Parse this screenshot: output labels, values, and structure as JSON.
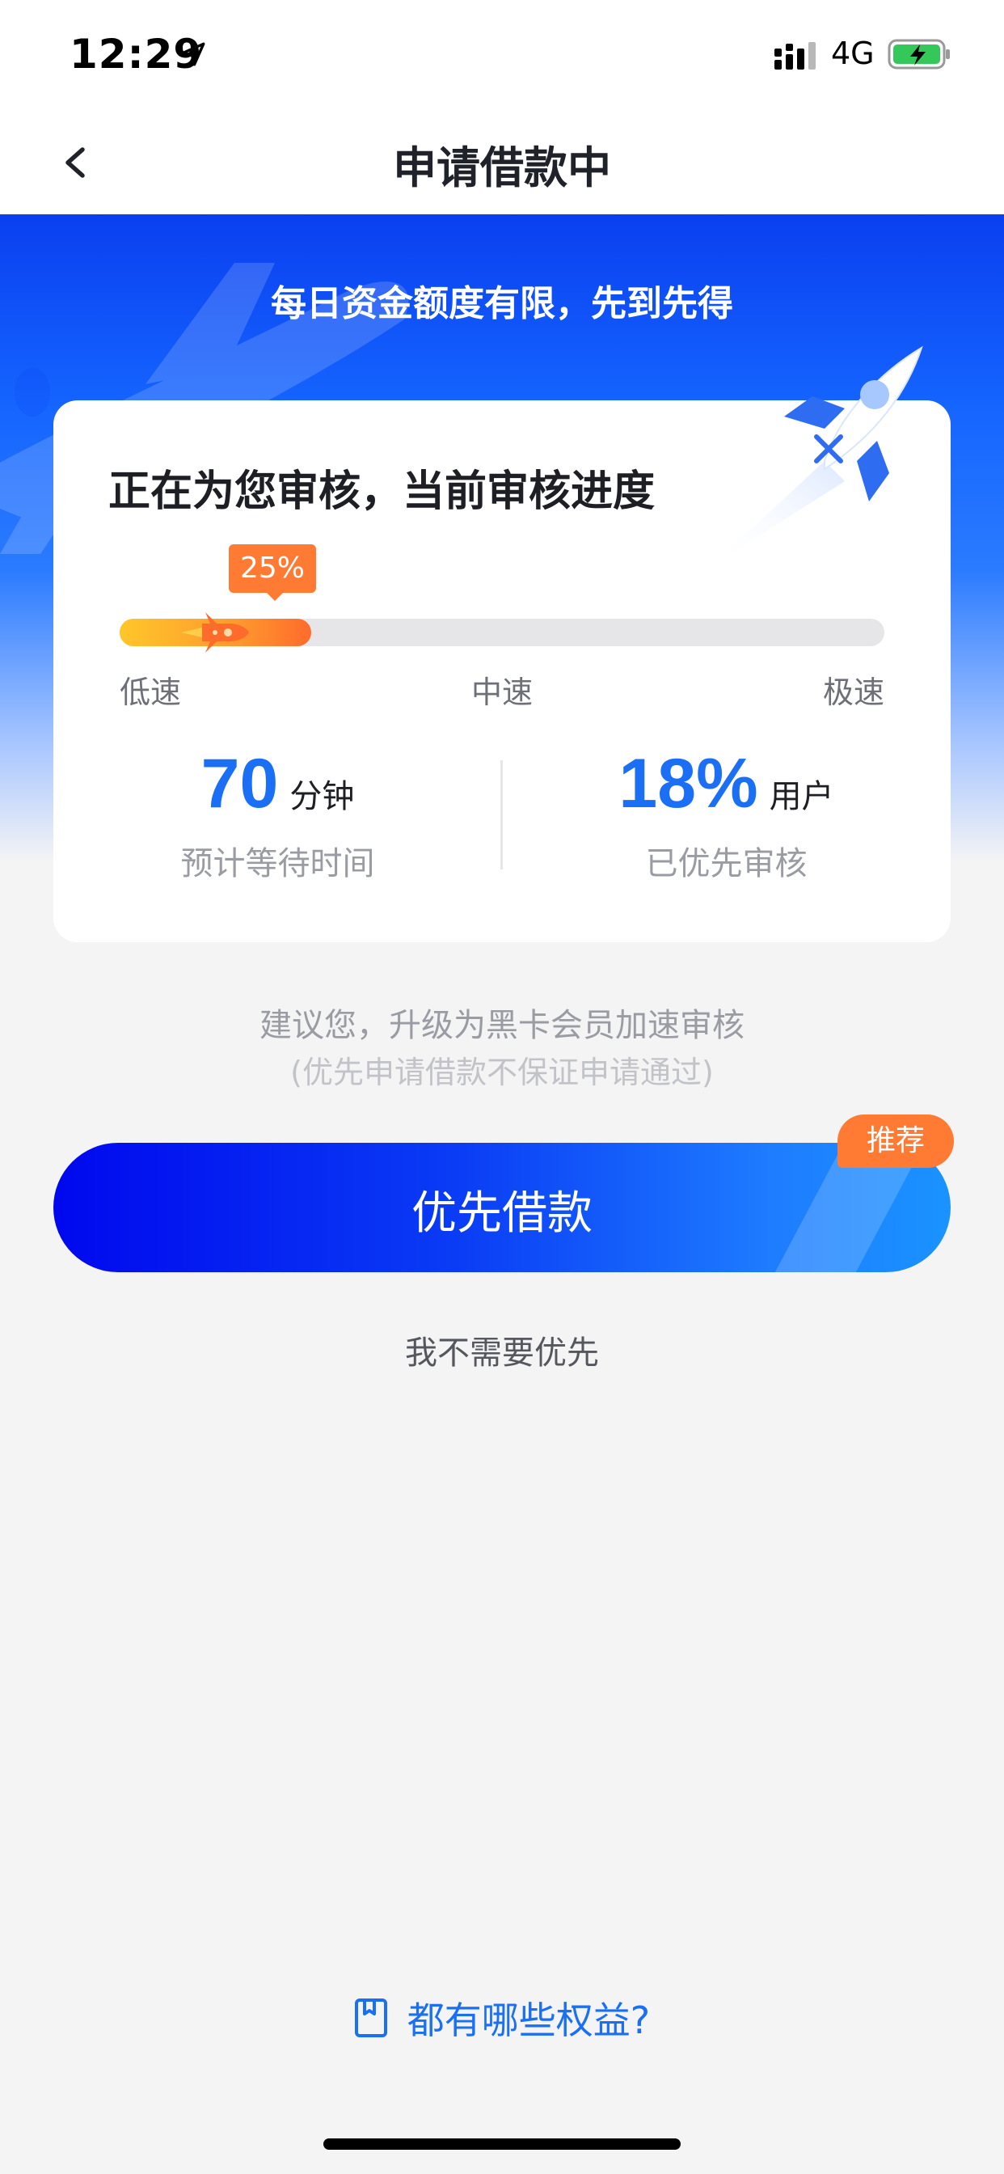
{
  "status_bar": {
    "time": "12:29",
    "network": "4G",
    "icons": [
      "location-arrow-icon",
      "signal-bars-icon",
      "battery-charging-icon"
    ]
  },
  "nav": {
    "title": "申请借款中",
    "back_icon": "chevron-left-icon"
  },
  "hero": {
    "slogan": "每日资金额度有限，先到先得"
  },
  "card": {
    "title": "正在为您审核，当前审核进度",
    "progress_label": "25%",
    "progress_fraction": 0.25,
    "speed_labels": {
      "low": "低速",
      "mid": "中速",
      "high": "极速"
    },
    "stats": [
      {
        "value": "70",
        "unit": "分钟",
        "desc": "预计等待时间"
      },
      {
        "value": "18%",
        "unit": "用户",
        "desc": "已优先审核"
      }
    ]
  },
  "suggestion": {
    "text": "建议您，升级为黑卡会员加速审核",
    "note": "(优先申请借款不保证申请通过)"
  },
  "priority_button": {
    "label": "优先借款",
    "tag": "推荐"
  },
  "skip": {
    "label": "我不需要优先"
  },
  "benefits": {
    "label": "都有哪些权益?",
    "icon": "bookmark-icon"
  },
  "colors": {
    "primary_blue": "#1a6ff5",
    "accent_orange": "#ff7a33",
    "button_gradient_start": "#0008ee",
    "button_gradient_end": "#1a93ff"
  }
}
